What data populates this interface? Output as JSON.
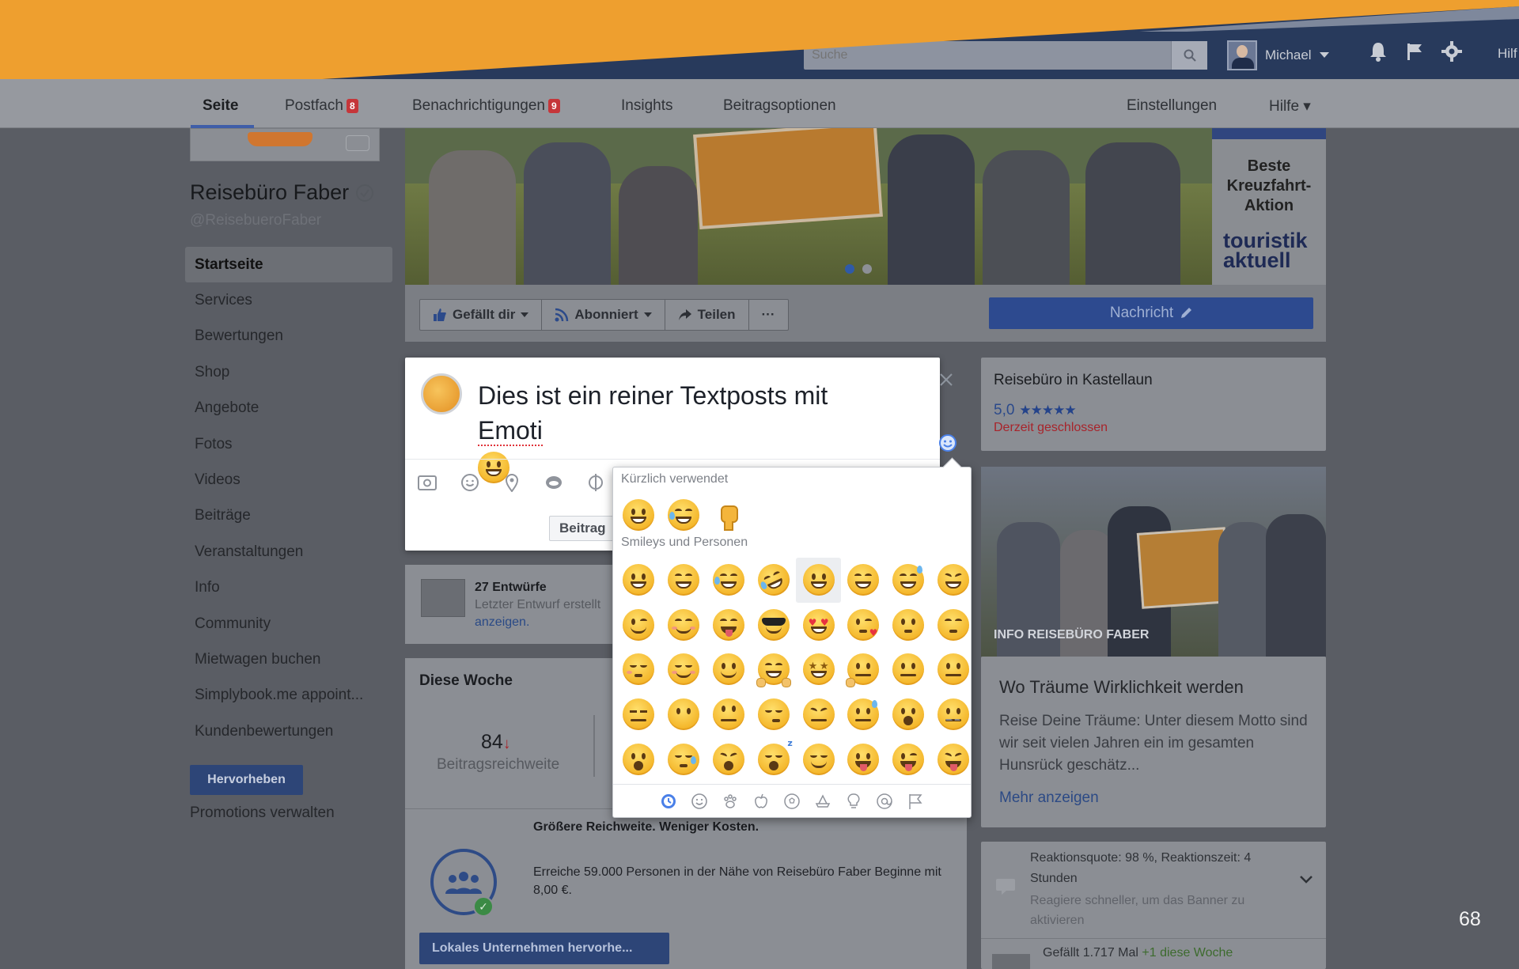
{
  "topbar": {
    "search_placeholder": "Suche",
    "user_name": "Michael",
    "help": "Hilf"
  },
  "subnav": {
    "items": [
      {
        "label": "Seite"
      },
      {
        "label": "Postfach",
        "badge": "8"
      },
      {
        "label": "Benachrichtigungen",
        "badge": "9"
      },
      {
        "label": "Insights"
      },
      {
        "label": "Beitragsoptionen"
      }
    ],
    "settings": "Einstellungen",
    "help": "Hilfe ▾"
  },
  "page": {
    "name": "Reisebüro Faber",
    "handle": "@ReisebueroFaber"
  },
  "sidebar": {
    "items": [
      {
        "label": "Startseite"
      },
      {
        "label": "Services"
      },
      {
        "label": "Bewertungen"
      },
      {
        "label": "Shop"
      },
      {
        "label": "Angebote"
      },
      {
        "label": "Fotos"
      },
      {
        "label": "Videos"
      },
      {
        "label": "Beiträge"
      },
      {
        "label": "Veranstaltungen"
      },
      {
        "label": "Info"
      },
      {
        "label": "Community"
      },
      {
        "label": "Mietwagen buchen"
      },
      {
        "label": "Simplybook.me appoint..."
      },
      {
        "label": "Kundenbewertungen"
      }
    ],
    "promote_button": "Hervorheben",
    "promotions_link": "Promotions verwalten"
  },
  "cover": {
    "ad_title": "Beste Kreuzfahrt-Aktion",
    "ad_logo_line1": "touristik",
    "ad_logo_line2": "aktuell"
  },
  "actions": {
    "like": "Gefällt dir",
    "follow": "Abonniert",
    "share": "Teilen",
    "more": "···",
    "message": "Nachricht"
  },
  "composer": {
    "text": "Dies ist ein reiner Textposts mit",
    "misspelled": "Emoti",
    "post_button": "Beitrag"
  },
  "emoji_picker": {
    "recent_label": "Kürzlich verwendet",
    "smileys_label": "Smileys und Personen",
    "recent": [
      "grinning",
      "joy",
      "fist"
    ],
    "smileys": [
      "grinning",
      "grin",
      "joy",
      "rofl",
      "smiley",
      "smile",
      "sweat-smile",
      "laughing",
      "wink",
      "blush",
      "yum",
      "sunglasses",
      "heart-eyes",
      "kissing-heart",
      "kissing",
      "kissing-smiling-eyes",
      "kissing-closed-eyes",
      "relaxed",
      "slight-smile",
      "hug",
      "star-struck",
      "thinking",
      "raised-eyebrow",
      "neutral",
      "expressionless",
      "no-mouth",
      "eye-roll",
      "smirk",
      "persevere",
      "disappointed-relieved",
      "open-mouth",
      "zipper-mouth",
      "hushed",
      "sleepy",
      "tired",
      "sleeping",
      "relieved",
      "tongue",
      "wink-tongue",
      "squint-tongue"
    ],
    "highlighted": "smiley",
    "categories": [
      "clock-icon",
      "smiley-icon",
      "paw-icon",
      "apple-icon",
      "ball-icon",
      "travel-icon",
      "bulb-icon",
      "at-icon",
      "flag-icon"
    ]
  },
  "info_card": {
    "title": "Reisebüro in Kastellaun",
    "rating": "5,0",
    "stars": "★★★★★",
    "status": "Derzeit geschlossen"
  },
  "photo_card": {
    "caption": "INFO REISEBÜRO FABER",
    "title": "Wo Träume Wirklichkeit werden",
    "description": "Reise Deine Träume: Unter diesem Motto sind wir seit vielen Jahren ein im gesamten Hunsrück geschätz...",
    "more": "Mehr anzeigen"
  },
  "response_card": {
    "text": "Reaktionsquote: 98 %, Reaktionszeit: 4 Stunden",
    "sub": "Reagiere schneller, um das Banner zu aktivieren"
  },
  "likes_card": {
    "text": "Gefällt 1.717 Mal",
    "delta": "+1 diese Woche"
  },
  "drafts": {
    "title": "27 Entwürfe",
    "sub": "Letzter Entwurf erstellt",
    "link": "anzeigen."
  },
  "week": {
    "title": "Diese Woche",
    "value": "84",
    "label": "Beitragsreichweite"
  },
  "promo": {
    "title": "Größere Reichweite. Weniger Kosten.",
    "description": "Erreiche 59.000 Personen in der Nähe von Reisebüro Faber Beginne mit 8,00 €.",
    "button": "Lokales Unternehmen hervorhe..."
  },
  "slide": {
    "page_number": "68",
    "accent": "#ee9f2f"
  }
}
